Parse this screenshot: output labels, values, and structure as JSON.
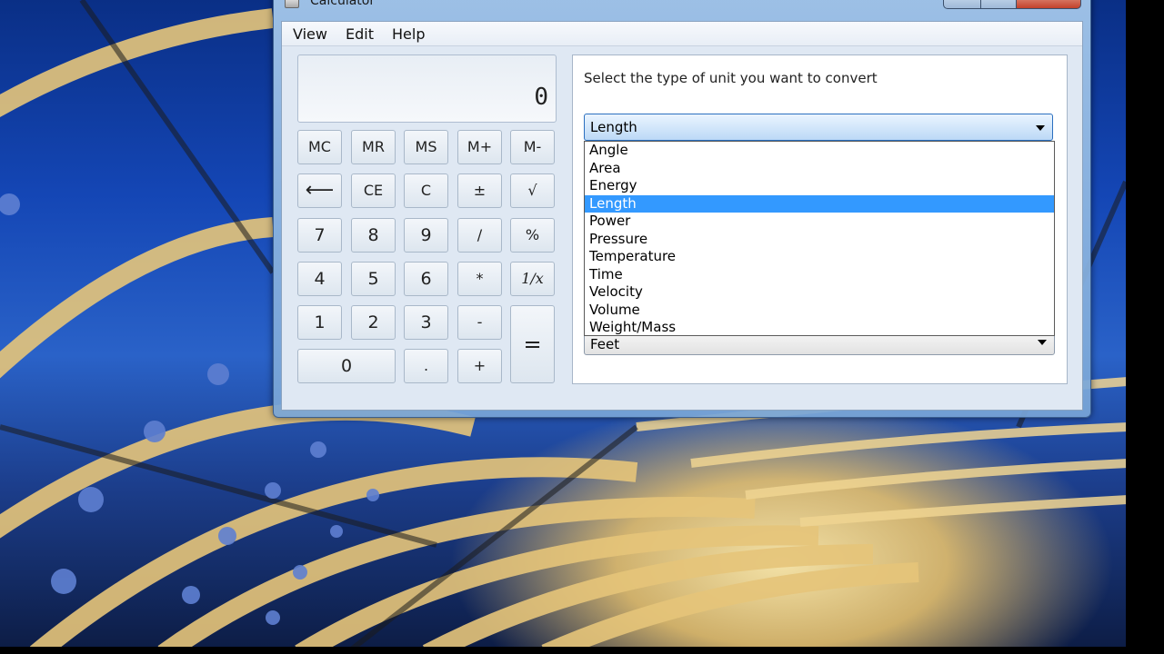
{
  "window": {
    "title": "Calculator"
  },
  "menu": {
    "view": "View",
    "edit": "Edit",
    "help": "Help"
  },
  "display": {
    "value": "0"
  },
  "keys": {
    "mc": "MC",
    "mr": "MR",
    "ms": "MS",
    "mplus": "M+",
    "mminus": "M-",
    "backspace": "⟵",
    "ce": "CE",
    "c": "C",
    "plusminus": "±",
    "sqrt": "√",
    "n7": "7",
    "n8": "8",
    "n9": "9",
    "divide": "/",
    "percent": "%",
    "n4": "4",
    "n5": "5",
    "n6": "6",
    "multiply": "*",
    "reciprocal": "1/x",
    "n1": "1",
    "n2": "2",
    "n3": "3",
    "subtract": "-",
    "equals": "=",
    "n0": "0",
    "decimal": ".",
    "add": "+"
  },
  "converter": {
    "prompt": "Select the type of unit you want to convert",
    "selected_type": "Length",
    "options": [
      "Angle",
      "Area",
      "Energy",
      "Length",
      "Power",
      "Pressure",
      "Temperature",
      "Time",
      "Velocity",
      "Volume",
      "Weight/Mass"
    ],
    "selected_index": 3,
    "to_unit_value": "Feet"
  },
  "colors": {
    "highlight": "#3399ff",
    "desktop_sky": "#1446b5"
  }
}
